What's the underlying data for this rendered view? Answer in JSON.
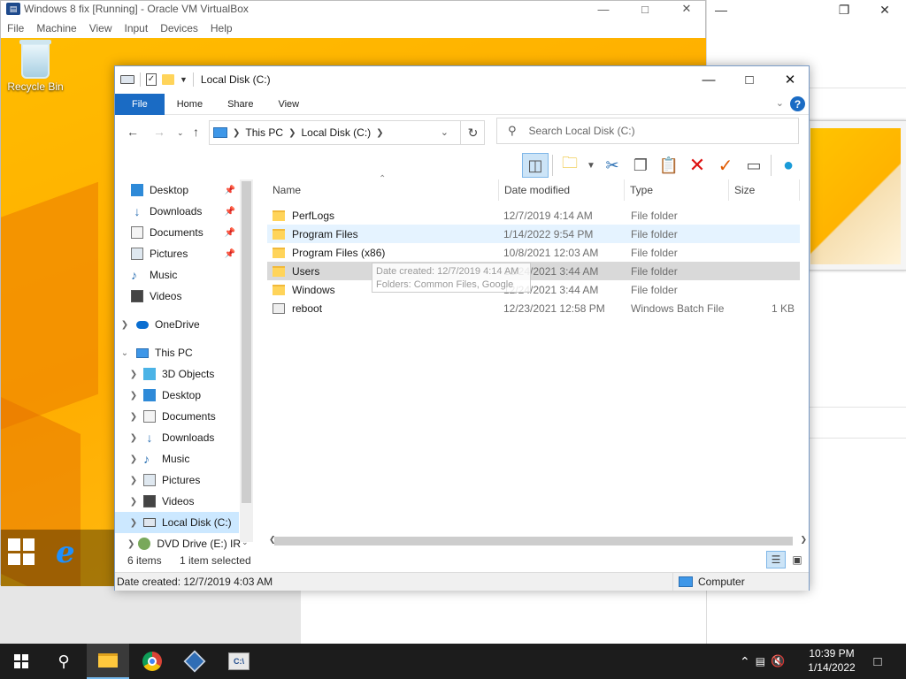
{
  "vbox": {
    "title": "Windows 8 fix [Running] - Oracle VM VirtualBox",
    "menu": [
      "File",
      "Machine",
      "View",
      "Input",
      "Devices",
      "Help"
    ]
  },
  "guest": {
    "desktop_icon": "Recycle Bin"
  },
  "explorer": {
    "title": "Local Disk (C:)",
    "ribbon_tabs": [
      "File",
      "Home",
      "Share",
      "View"
    ],
    "address": [
      "This PC",
      "Local Disk (C:)"
    ],
    "search_placeholder": "Search Local Disk (C:)",
    "toolbar_icons": [
      "preview-pane-icon",
      "new-folder-icon",
      "cut-icon",
      "copy-icon",
      "paste-icon",
      "delete-icon",
      "properties-check-icon",
      "rename-icon",
      "network-globe-icon"
    ],
    "nav": {
      "quick_access": [
        {
          "label": "Desktop",
          "icon": "desktop-icon",
          "pinned": true
        },
        {
          "label": "Downloads",
          "icon": "downloads-icon",
          "pinned": true
        },
        {
          "label": "Documents",
          "icon": "documents-icon",
          "pinned": true
        },
        {
          "label": "Pictures",
          "icon": "pictures-icon",
          "pinned": true
        },
        {
          "label": "Music",
          "icon": "music-icon",
          "pinned": false
        },
        {
          "label": "Videos",
          "icon": "videos-icon",
          "pinned": false
        }
      ],
      "onedrive": "OneDrive",
      "this_pc": "This PC",
      "this_pc_children": [
        {
          "label": "3D Objects",
          "icon": "3d-objects-icon"
        },
        {
          "label": "Desktop",
          "icon": "desktop-icon"
        },
        {
          "label": "Documents",
          "icon": "documents-icon"
        },
        {
          "label": "Downloads",
          "icon": "downloads-icon"
        },
        {
          "label": "Music",
          "icon": "music-icon"
        },
        {
          "label": "Pictures",
          "icon": "pictures-icon"
        },
        {
          "label": "Videos",
          "icon": "videos-icon"
        },
        {
          "label": "Local Disk (C:)",
          "icon": "drive-icon",
          "selected": true
        },
        {
          "label": "DVD Drive (E:) IR",
          "icon": "dvd-drive-icon"
        }
      ]
    },
    "columns": [
      "Name",
      "Date modified",
      "Type",
      "Size"
    ],
    "files": [
      {
        "name": "PerfLogs",
        "date": "12/7/2019 4:14 AM",
        "type": "File folder",
        "size": "",
        "kind": "folder"
      },
      {
        "name": "Program Files",
        "date": "1/14/2022 9:54 PM",
        "type": "File folder",
        "size": "",
        "kind": "folder"
      },
      {
        "name": "Program Files (x86)",
        "date": "10/8/2021 12:03 AM",
        "type": "File folder",
        "size": "",
        "kind": "folder"
      },
      {
        "name": "Users",
        "date": "12/24/2021 3:44 AM",
        "type": "File folder",
        "size": "",
        "kind": "folder"
      },
      {
        "name": "Windows",
        "date": "12/24/2021 3:44 AM",
        "type": "File folder",
        "size": "",
        "kind": "folder"
      },
      {
        "name": "reboot",
        "date": "12/23/2021 12:58 PM",
        "type": "Windows Batch File",
        "size": "1 KB",
        "kind": "batch"
      }
    ],
    "hovered_row": 1,
    "selected_row": 3,
    "tooltip": {
      "line1": "Date created: 12/7/2019 4:14 AM",
      "line2": "Folders: Common Files, Google"
    },
    "status_items": "6 items",
    "status_selected": "1 item selected",
    "bottom_status": "Date created: 12/7/2019 4:03 AM",
    "bottom_zone": "Computer"
  },
  "taskbar": {
    "apps": [
      "file-explorer-icon",
      "chrome-icon",
      "virtualbox-icon",
      "command-prompt-icon"
    ],
    "cmd_badge": "C:\\",
    "time": "10:39 PM",
    "date": "1/14/2022"
  }
}
